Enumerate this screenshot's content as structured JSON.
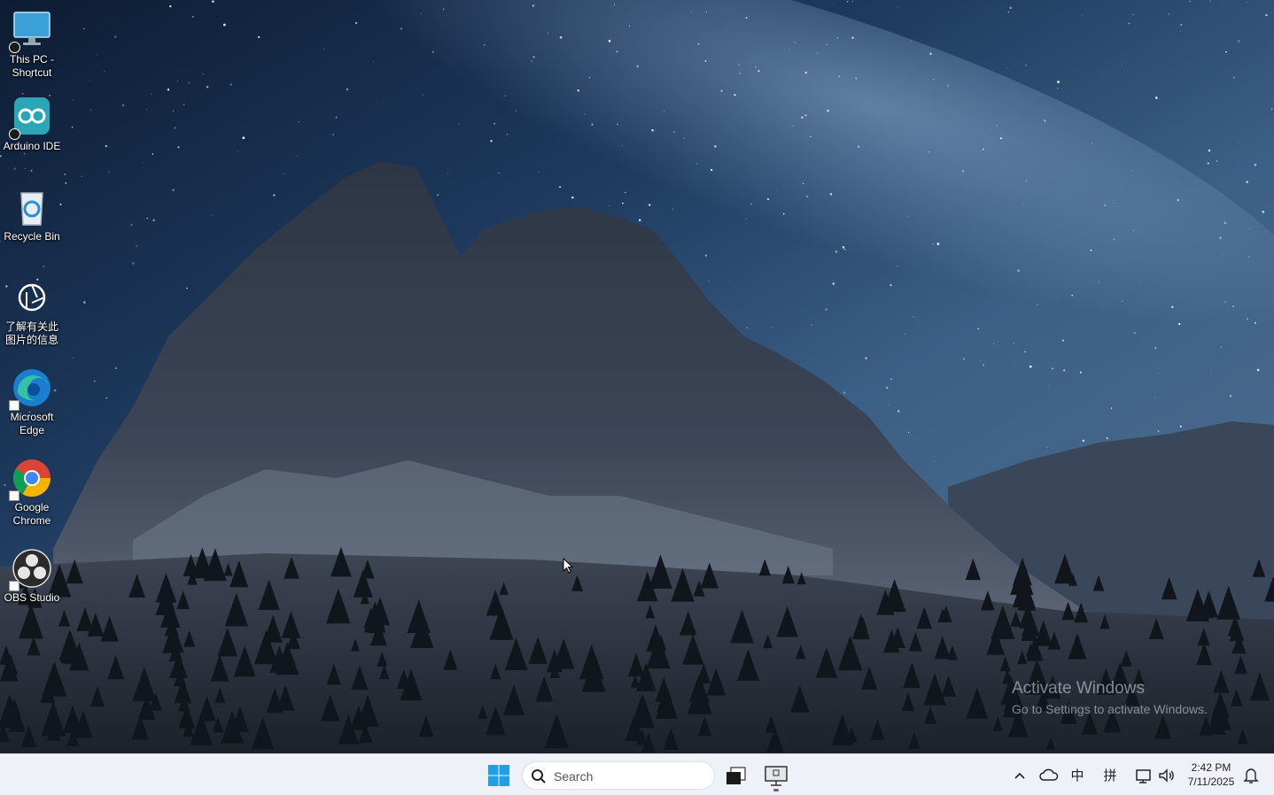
{
  "desktop": {
    "icons": [
      {
        "label": "This PC -\nShortcut",
        "icon": "monitor-icon",
        "badge": "sync-check"
      },
      {
        "label": "Arduino IDE",
        "icon": "arduino-icon",
        "badge": "sync-check"
      },
      {
        "label": "Recycle Bin",
        "icon": "recycle-bin-icon",
        "badge": ""
      },
      {
        "label": "了解有关此\n图片的信息",
        "icon": "camera-lens-icon",
        "badge": ""
      },
      {
        "label": "Microsoft\nEdge",
        "icon": "edge-icon",
        "badge": "shortcut-arrow"
      },
      {
        "label": "Google\nChrome",
        "icon": "chrome-icon",
        "badge": "shortcut-arrow"
      },
      {
        "label": "OBS Studio",
        "icon": "obs-icon",
        "badge": "shortcut-arrow"
      }
    ]
  },
  "watermark": {
    "title": "Activate Windows",
    "subtitle": "Go to Settings to activate Windows."
  },
  "taskbar": {
    "search_placeholder": "Search",
    "tray": {
      "ime_mode": "中",
      "ime_pinyin": "拼"
    },
    "clock": {
      "time": "2:42 PM",
      "date": "7/11/2025"
    }
  },
  "colors": {
    "taskbar_bg": "#eef1f7",
    "windows_blue": "#1ea0e6"
  }
}
